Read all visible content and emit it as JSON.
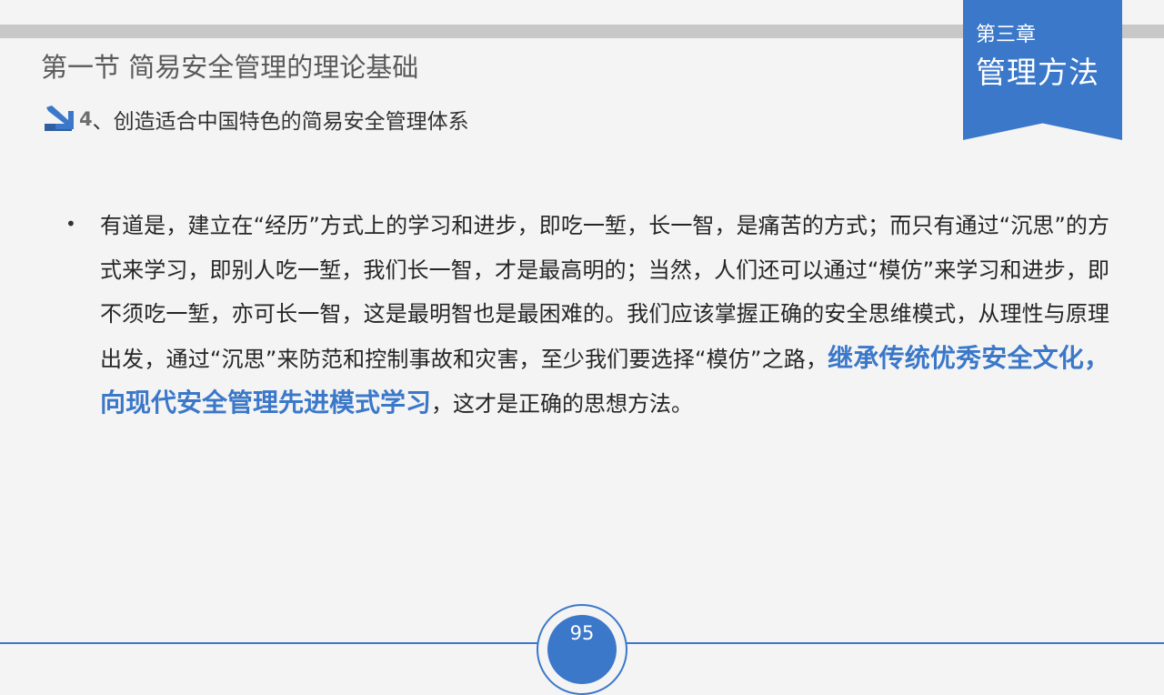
{
  "chapter": {
    "number": "第三章",
    "title": "管理方法"
  },
  "section_title": "第一节  简易安全管理的理论基础",
  "subtitle": {
    "number": "4",
    "text": "、创造适合中国特色的简易安全管理体系"
  },
  "bullet": {
    "symbol": "•",
    "text_before": "有道是，建立在“经历”方式上的学习和进步，即吃一堑，长一智，是痛苦的方式；而只有通过“沉思”的方式来学习，即别人吃一堑，我们长一智，才是最高明的；当然，人们还可以通过“模仿”来学习和进步，即不须吃一堑，亦可长一智，这是最明智也是最困难的。我们应该掌握正确的安全思维模式，从理性与原理出发，通过“沉思”来防范和控制事故和灾害，至少我们要选择“模仿”之路，",
    "highlight": "继承传统优秀安全文化，向现代安全管理先进模式学习",
    "text_after": "，这才是正确的思想方法。"
  },
  "page_number": "95",
  "colors": {
    "accent": "#3b78c9",
    "top_bar": "#c8c8c8",
    "background": "#f4f4f4"
  },
  "icons": {
    "subtitle_marker": "arrow-down-right-icon"
  }
}
